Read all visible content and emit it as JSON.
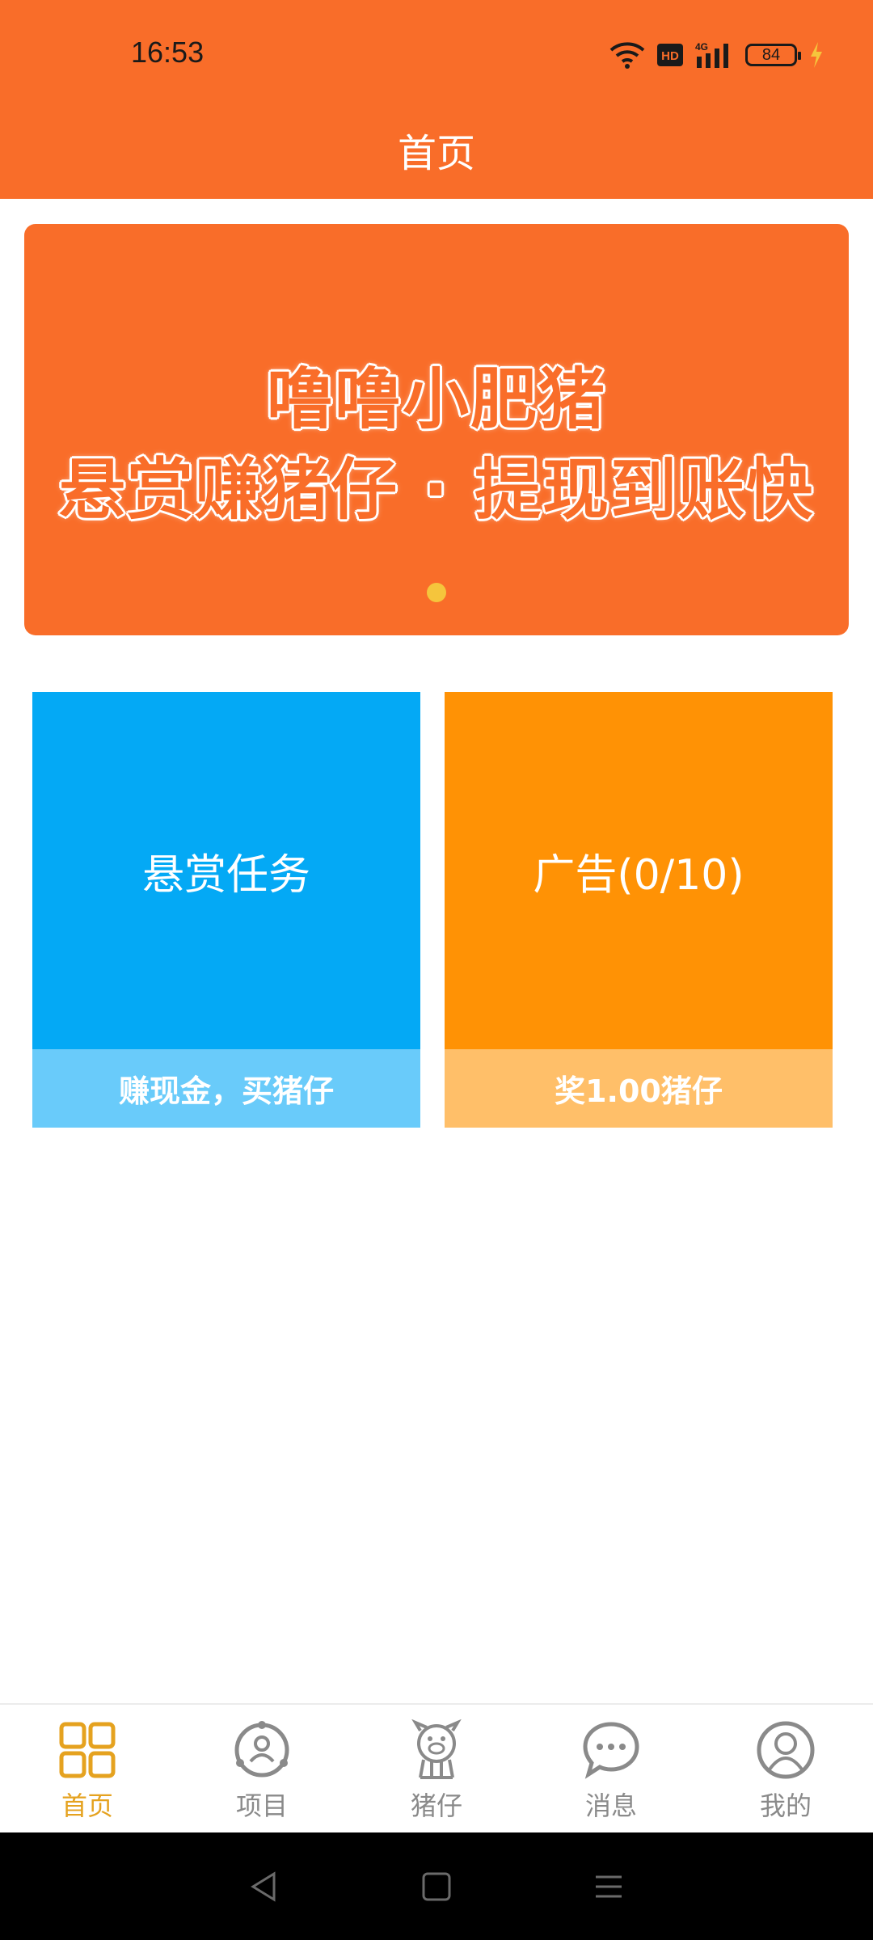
{
  "status_bar": {
    "time": "16:53",
    "battery_level": "84",
    "icons": [
      "wifi-icon",
      "hd-icon",
      "4g-signal-icon",
      "battery-icon",
      "charging-icon"
    ]
  },
  "header": {
    "title": "首页"
  },
  "banner": {
    "line1": "噜噜小肥猪",
    "line2": "悬赏赚猪仔 · 提现到账快",
    "indicator_color": "#F5C53C"
  },
  "cards": [
    {
      "title": "悬赏任务",
      "subtitle": "赚现金，买猪仔",
      "color": "#04A9F5",
      "sub_color": "#69CBFA"
    },
    {
      "title": "广告(0/10)",
      "subtitle": "奖1.00猪仔",
      "color": "#FF9205",
      "sub_color": "#FFBF69"
    }
  ],
  "tabbar": {
    "items": [
      {
        "label": "首页",
        "icon": "grid-icon",
        "active": true
      },
      {
        "label": "项目",
        "icon": "project-icon",
        "active": false
      },
      {
        "label": "猪仔",
        "icon": "pig-icon",
        "active": false
      },
      {
        "label": "消息",
        "icon": "message-icon",
        "active": false
      },
      {
        "label": "我的",
        "icon": "profile-icon",
        "active": false
      }
    ]
  },
  "colors": {
    "brand": "#F96D29",
    "active_tab": "#E5A21F",
    "inactive_tab": "#8a8a8a"
  },
  "navbar": {
    "icons": [
      "back-icon",
      "home-icon",
      "menu-icon"
    ]
  }
}
